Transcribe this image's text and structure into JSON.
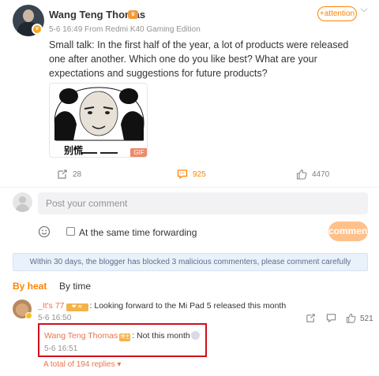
{
  "post": {
    "author": "Wang Teng Thomas",
    "timestamp": "5-6 16:49",
    "source": "From Redmi K40 Gaming Edition",
    "follow_label": "+attention",
    "text": "Small talk: In the first half of the year, a lot of products were released one after another. Which one do you like best? What are your expectations and suggestions for future products?",
    "image_caption": "别慌",
    "image_badge": "GIF"
  },
  "actions": {
    "repost_count": "28",
    "comment_count": "925",
    "like_count": "4470"
  },
  "composer": {
    "placeholder": "Post your comment",
    "forward_label": "At the same time forwarding",
    "submit_label": "comment"
  },
  "notice": "Within 30 days, the blogger has blocked 3 malicious commenters, please comment carefully",
  "tabs": [
    "By heat",
    "By time"
  ],
  "comment": {
    "user": "_It's 77",
    "text": ": Looking forward to the Mi Pad 5 released this month",
    "time": "5-6 16:50",
    "like_count": "521",
    "reply": {
      "user": "Wang Teng Thomas",
      "tag": "博主",
      "text": ": Not this month",
      "time": "5-6 16:51"
    },
    "total_replies": "A total of 194 replies ▾"
  },
  "colors": {
    "accent": "#ff8200",
    "username_link": "#eb7350",
    "highlight_border": "#d0101b"
  }
}
